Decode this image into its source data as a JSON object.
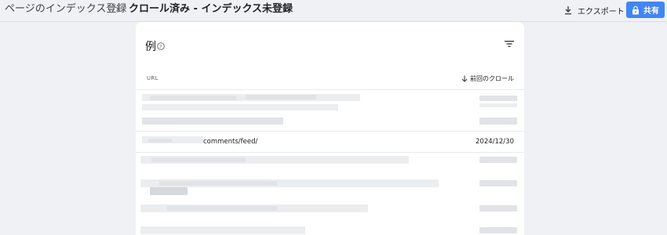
{
  "breadcrumb": {
    "parent": "ページのインデックス登録",
    "separator": "›",
    "current": "クロール済み - インデックス未登録"
  },
  "actions": {
    "export_label": "エクスポート",
    "share_label": "共有",
    "share_color": "#4285f4"
  },
  "card": {
    "title": "例",
    "columns": {
      "url": "URL",
      "last_crawl": "前回のクロール"
    },
    "visible_row": {
      "url": "comments/feed/",
      "date": "2024/12/30"
    }
  },
  "icons": [
    "download-icon",
    "lock-icon",
    "help-icon",
    "filter-icon",
    "arrow-down-icon"
  ]
}
